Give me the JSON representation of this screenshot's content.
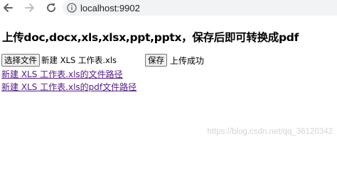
{
  "browser": {
    "url": "localhost:9902"
  },
  "page": {
    "title": "上传doc,docx,xls,xlsx,ppt,pptx，保存后即可转换成pdf",
    "choose_file_label": "选择文件",
    "selected_file": "新建 XLS 工作表.xls",
    "save_label": "保存",
    "status": "上传成功",
    "xls_path_link": "新建 XLS 工作表.xls的文件路径",
    "pdf_path_link": "新建 XLS 工作表.xls的pdf文件路径"
  },
  "watermark": "https://blog.csdn.net/qq_36120342",
  "icons": {
    "back": "arrow-left-icon",
    "forward": "arrow-right-icon",
    "reload": "reload-icon",
    "info": "info-icon"
  }
}
